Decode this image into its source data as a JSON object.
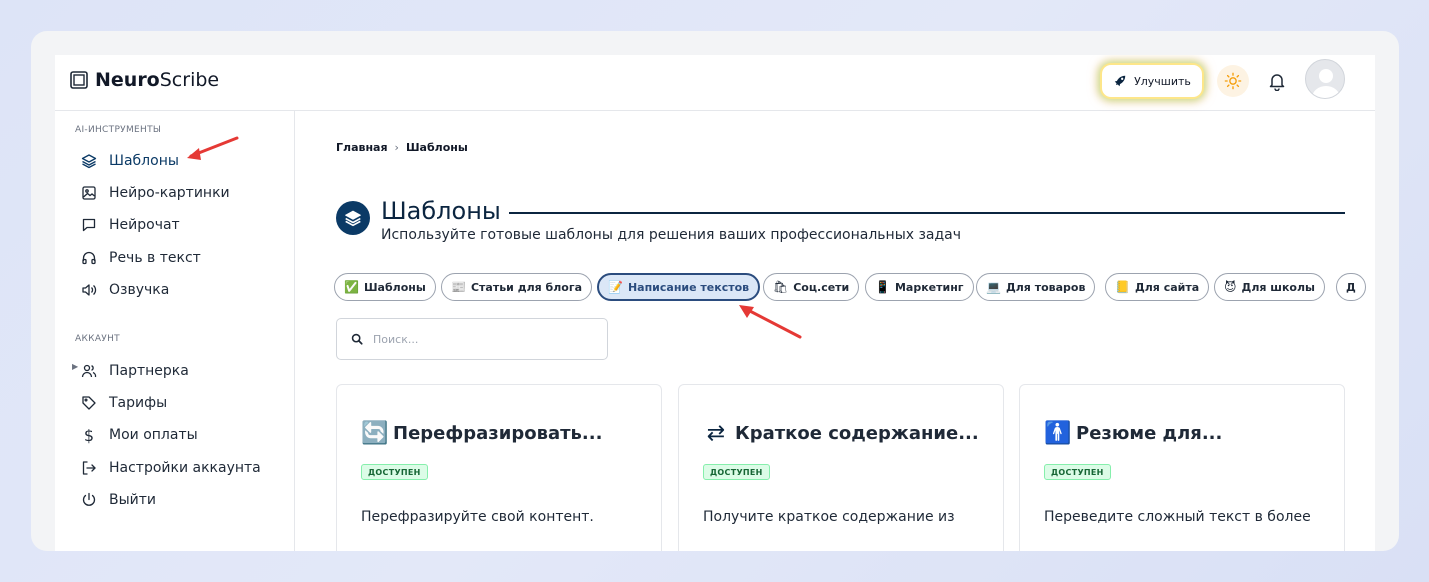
{
  "header": {
    "logo_bold": "Neuro",
    "logo_rest": "Scribe",
    "upgrade_label": "Улучшить"
  },
  "sidebar": {
    "sections": [
      {
        "title": "AI-ИНСТРУМЕНТЫ",
        "items": [
          {
            "label": "Шаблоны",
            "icon": "layers-icon",
            "active": true
          },
          {
            "label": "Нейро-картинки",
            "icon": "image-icon"
          },
          {
            "label": "Нейрочат",
            "icon": "chat-icon"
          },
          {
            "label": "Речь в текст",
            "icon": "headphones-icon"
          },
          {
            "label": "Озвучка",
            "icon": "speaker-icon"
          }
        ]
      },
      {
        "title": "АККАУНТ",
        "items": [
          {
            "label": "Партнерка",
            "icon": "users-icon",
            "expandable": true
          },
          {
            "label": "Тарифы",
            "icon": "tag-icon"
          },
          {
            "label": "Мои оплаты",
            "icon": "dollar-icon"
          },
          {
            "label": "Настройки аккаунта",
            "icon": "login-icon"
          },
          {
            "label": "Выйти",
            "icon": "power-icon"
          }
        ]
      }
    ]
  },
  "main": {
    "breadcrumb": [
      "Главная",
      "Шаблоны"
    ],
    "breadcrumb_sep": "›",
    "title": "Шаблоны",
    "subtitle": "Используйте готовые шаблоны для решения ваших профессиональных задач",
    "chips": [
      {
        "icon": "✅",
        "label": "Шаблоны"
      },
      {
        "icon": "📰",
        "label": "Статьи для блога"
      },
      {
        "icon": "📝",
        "label": "Написание текстов",
        "active": true
      },
      {
        "icon": "🛍",
        "label": "Соц.сети"
      },
      {
        "icon": "📱",
        "label": "Маркетинг"
      },
      {
        "icon": "💻",
        "label": "Для товаров"
      },
      {
        "icon": "📒",
        "label": "Для сайта"
      },
      {
        "icon": "😈",
        "label": "Для школы"
      },
      {
        "icon": "Д",
        "label": ""
      }
    ],
    "search_placeholder": "Поиск...",
    "cards": [
      {
        "icon": "🔄",
        "title": "Перефразировать...",
        "badge": "ДОСТУПЕН",
        "desc": "Перефразируйте свой контент."
      },
      {
        "icon": "⇄",
        "title": "Краткое содержание...",
        "badge": "ДОСТУПЕН",
        "desc": "Получите краткое содержание из"
      },
      {
        "icon": "🚹",
        "title": "Резюме для...",
        "badge": "ДОСТУПЕН",
        "desc": "Переведите сложный текст в более"
      }
    ]
  },
  "colors": {
    "accent": "#0b3a66",
    "annotation_arrow": "#e53935",
    "badge_bg": "#dcfce7"
  }
}
